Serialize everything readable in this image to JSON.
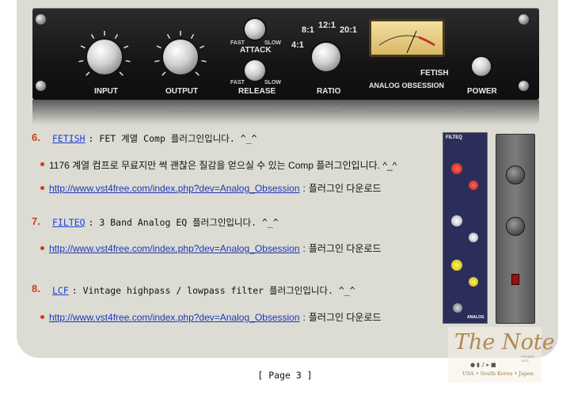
{
  "plugin": {
    "labels": {
      "input": "INPUT",
      "output": "OUTPUT",
      "attack": "ATTACK",
      "release": "RELEASE",
      "ratio": "RATIO",
      "power": "POWER",
      "fast1": "FAST",
      "slow1": "SLOW",
      "fast2": "FAST",
      "slow2": "SLOW",
      "ratio_4": "4:1",
      "ratio_8": "8:1",
      "ratio_12": "12:1",
      "ratio_20": "20:1",
      "brand": "FETISH",
      "maker": "ANALOG OBSESSION"
    }
  },
  "items": [
    {
      "number": "6.",
      "name": "FETISH",
      "desc": ": FET 계열 Comp 플러그인입니다. ^_^",
      "bullets": [
        {
          "text": "1176 계열 컴프로 무료지만 썩 괜찮은 질감을 얻으실 수 있는 Comp 플러그인입니다. ^_^"
        },
        {
          "link": "http://www.vst4free.com/index.php?dev=Analog_Obsession",
          "sep": ":",
          "suffix": "플러그인 다운로드"
        }
      ]
    },
    {
      "number": "7.",
      "name": "FILTEQ",
      "desc": ": 3 Band Analog EQ 플러그인입니다. ^_^",
      "bullets": [
        {
          "link": "http://www.vst4free.com/index.php?dev=Analog_Obsession",
          "sep": ":",
          "suffix": "플러그인 다운로드"
        }
      ]
    },
    {
      "number": "8.",
      "name": "LCF",
      "desc": ": Vintage highpass / lowpass filter 플러그인입니다. ^_^",
      "bullets": [
        {
          "link": "http://www.vst4free.com/index.php?dev=Analog_Obsession",
          "sep": ":",
          "suffix": "플러그인 다운로드"
        }
      ]
    }
  ],
  "side_images": {
    "filteq_label": "FILTEQ",
    "filteq_footer": "ANALOG"
  },
  "watermark": {
    "title": "The Note",
    "subtitle": "USA • South Korea • Japan",
    "small": "STUDIO 2011"
  },
  "pager": "[ Page 3 ]",
  "colors": {
    "accent": "#d23a1b",
    "link": "#1f3fd6",
    "panel": "#dcdcd4"
  }
}
